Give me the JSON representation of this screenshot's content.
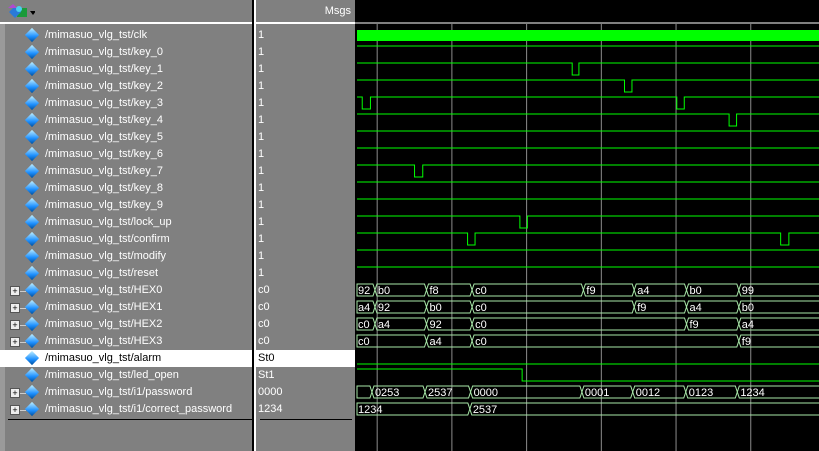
{
  "header": {
    "msgs_label": "Msgs",
    "toolbar_icon": "wave-tool-icon"
  },
  "time_view": {
    "start": 73,
    "end": 694,
    "grid_step": 100,
    "grid_first": 100
  },
  "colors": {
    "signal": "#00ff00",
    "bus": "#a8e8a8",
    "grid": "#8c8c8c",
    "panel": "#808080"
  },
  "signals": [
    {
      "name": "/mimasuo_vlg_tst/clk",
      "value": "1",
      "kind": "clock"
    },
    {
      "name": "/mimasuo_vlg_tst/key_0",
      "value": "1",
      "kind": "bit",
      "init": 1,
      "edges": []
    },
    {
      "name": "/mimasuo_vlg_tst/key_1",
      "value": "1",
      "kind": "bit",
      "init": 1,
      "edges": [
        361,
        370
      ]
    },
    {
      "name": "/mimasuo_vlg_tst/key_2",
      "value": "1",
      "kind": "bit",
      "init": 1,
      "edges": [
        431,
        441
      ]
    },
    {
      "name": "/mimasuo_vlg_tst/key_3",
      "value": "1",
      "kind": "bit",
      "init": 1,
      "edges": [
        80,
        91,
        501,
        511
      ]
    },
    {
      "name": "/mimasuo_vlg_tst/key_4",
      "value": "1",
      "kind": "bit",
      "init": 1,
      "edges": [
        571,
        581
      ]
    },
    {
      "name": "/mimasuo_vlg_tst/key_5",
      "value": "1",
      "kind": "bit",
      "init": 1,
      "edges": []
    },
    {
      "name": "/mimasuo_vlg_tst/key_6",
      "value": "1",
      "kind": "bit",
      "init": 1,
      "edges": []
    },
    {
      "name": "/mimasuo_vlg_tst/key_7",
      "value": "1",
      "kind": "bit",
      "init": 1,
      "edges": [
        150,
        161
      ]
    },
    {
      "name": "/mimasuo_vlg_tst/key_8",
      "value": "1",
      "kind": "bit",
      "init": 1,
      "edges": []
    },
    {
      "name": "/mimasuo_vlg_tst/key_9",
      "value": "1",
      "kind": "bit",
      "init": 1,
      "edges": []
    },
    {
      "name": "/mimasuo_vlg_tst/lock_up",
      "value": "1",
      "kind": "bit",
      "init": 1,
      "edges": [
        291,
        301
      ]
    },
    {
      "name": "/mimasuo_vlg_tst/confirm",
      "value": "1",
      "kind": "bit",
      "init": 1,
      "edges": [
        221,
        231,
        640,
        651
      ]
    },
    {
      "name": "/mimasuo_vlg_tst/modify",
      "value": "1",
      "kind": "bit",
      "init": 1,
      "edges": []
    },
    {
      "name": "/mimasuo_vlg_tst/reset",
      "value": "1",
      "kind": "bit",
      "init": 1,
      "edges": []
    },
    {
      "name": "/mimasuo_vlg_tst/HEX0",
      "value": "c0",
      "kind": "bus",
      "segments": [
        [
          73,
          "92"
        ],
        [
          97,
          "b0"
        ],
        [
          166,
          "f8"
        ],
        [
          227,
          "c0"
        ],
        [
          376,
          "f9"
        ],
        [
          444,
          "a4"
        ],
        [
          514,
          "b0"
        ],
        [
          584,
          "99"
        ]
      ]
    },
    {
      "name": "/mimasuo_vlg_tst/HEX1",
      "value": "c0",
      "kind": "bus",
      "segments": [
        [
          73,
          "a4"
        ],
        [
          97,
          "92"
        ],
        [
          166,
          "b0"
        ],
        [
          227,
          "c0"
        ],
        [
          444,
          "f9"
        ],
        [
          514,
          "a4"
        ],
        [
          584,
          "b0"
        ]
      ]
    },
    {
      "name": "/mimasuo_vlg_tst/HEX2",
      "value": "c0",
      "kind": "bus",
      "segments": [
        [
          73,
          "c0"
        ],
        [
          97,
          "a4"
        ],
        [
          166,
          "92"
        ],
        [
          227,
          "c0"
        ],
        [
          514,
          "f9"
        ],
        [
          584,
          "a4"
        ]
      ]
    },
    {
      "name": "/mimasuo_vlg_tst/HEX3",
      "value": "c0",
      "kind": "bus",
      "segments": [
        [
          73,
          "c0"
        ],
        [
          166,
          "a4"
        ],
        [
          227,
          "c0"
        ],
        [
          584,
          "f9"
        ]
      ]
    },
    {
      "name": "/mimasuo_vlg_tst/alarm",
      "value": "St0",
      "kind": "bit",
      "init": 0,
      "edges": [],
      "selected": true
    },
    {
      "name": "/mimasuo_vlg_tst/led_open",
      "value": "St1",
      "kind": "bit",
      "init": 1,
      "edges": [
        294
      ]
    },
    {
      "name": "/mimasuo_vlg_tst/i1/password",
      "value": "0000",
      "kind": "bus",
      "segments": [
        [
          73,
          ""
        ],
        [
          93,
          "0253"
        ],
        [
          164,
          "2537"
        ],
        [
          225,
          "0000"
        ],
        [
          374,
          "0001"
        ],
        [
          442,
          "0012"
        ],
        [
          513,
          "0123"
        ],
        [
          582,
          "1234"
        ]
      ]
    },
    {
      "name": "/mimasuo_vlg_tst/i1/correct_password",
      "value": "1234",
      "kind": "bus",
      "segments": [
        [
          73,
          "1234"
        ],
        [
          224,
          "2537"
        ]
      ]
    }
  ]
}
